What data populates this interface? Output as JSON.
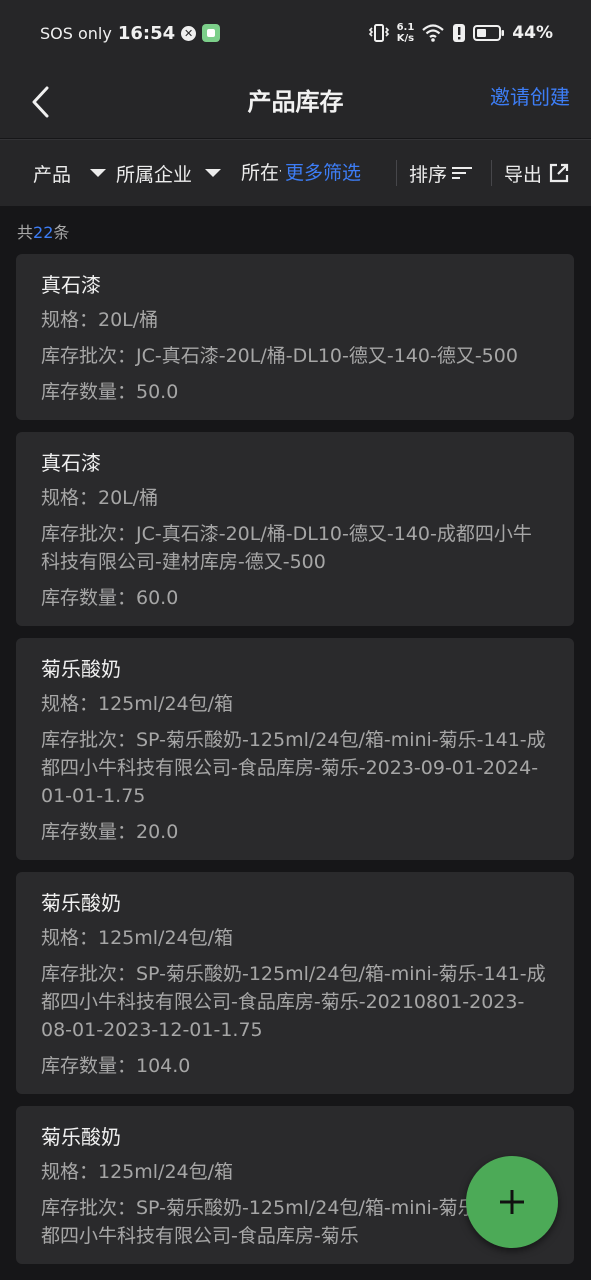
{
  "status_bar": {
    "sos": "SOS only",
    "time": "16:54",
    "speed_value": "6.1",
    "speed_unit": "K/s",
    "battery": "44%"
  },
  "header": {
    "title": "产品库存",
    "invite_label": "邀请创建"
  },
  "filters": {
    "product": "产品",
    "company": "所属企业",
    "clipped": "所在仓库",
    "more": "更多筛选",
    "sort": "排序",
    "export": "导出"
  },
  "summary": {
    "prefix": "共",
    "count": "22",
    "suffix": "条"
  },
  "items": [
    {
      "name": "真石漆",
      "spec": "规格：20L/桶",
      "batch": "库存批次：JC-真石漆-20L/桶-DL10-德又-140-德又-500",
      "qty": "库存数量：50.0"
    },
    {
      "name": "真石漆",
      "spec": "规格：20L/桶",
      "batch": "库存批次：JC-真石漆-20L/桶-DL10-德又-140-成都四小牛科技有限公司-建材库房-德又-500",
      "qty": "库存数量：60.0"
    },
    {
      "name": "菊乐酸奶",
      "spec": "规格：125ml/24包/箱",
      "batch": "库存批次：SP-菊乐酸奶-125ml/24包/箱-mini-菊乐-141-成都四小牛科技有限公司-食品库房-菊乐-2023-09-01-2024-01-01-1.75",
      "qty": "库存数量：20.0"
    },
    {
      "name": "菊乐酸奶",
      "spec": "规格：125ml/24包/箱",
      "batch": "库存批次：SP-菊乐酸奶-125ml/24包/箱-mini-菊乐-141-成都四小牛科技有限公司-食品库房-菊乐-20210801-2023-08-01-2023-12-01-1.75",
      "qty": "库存数量：104.0"
    },
    {
      "name": "菊乐酸奶",
      "spec": "规格：125ml/24包/箱",
      "batch": "库存批次：SP-菊乐酸奶-125ml/24包/箱-mini-菊乐-141-成都四小牛科技有限公司-食品库房-菊乐",
      "qty": ""
    }
  ],
  "colors": {
    "accent": "#3d7df5",
    "fab": "#4caa57",
    "card": "#2a2a2c",
    "background": "#161618"
  }
}
